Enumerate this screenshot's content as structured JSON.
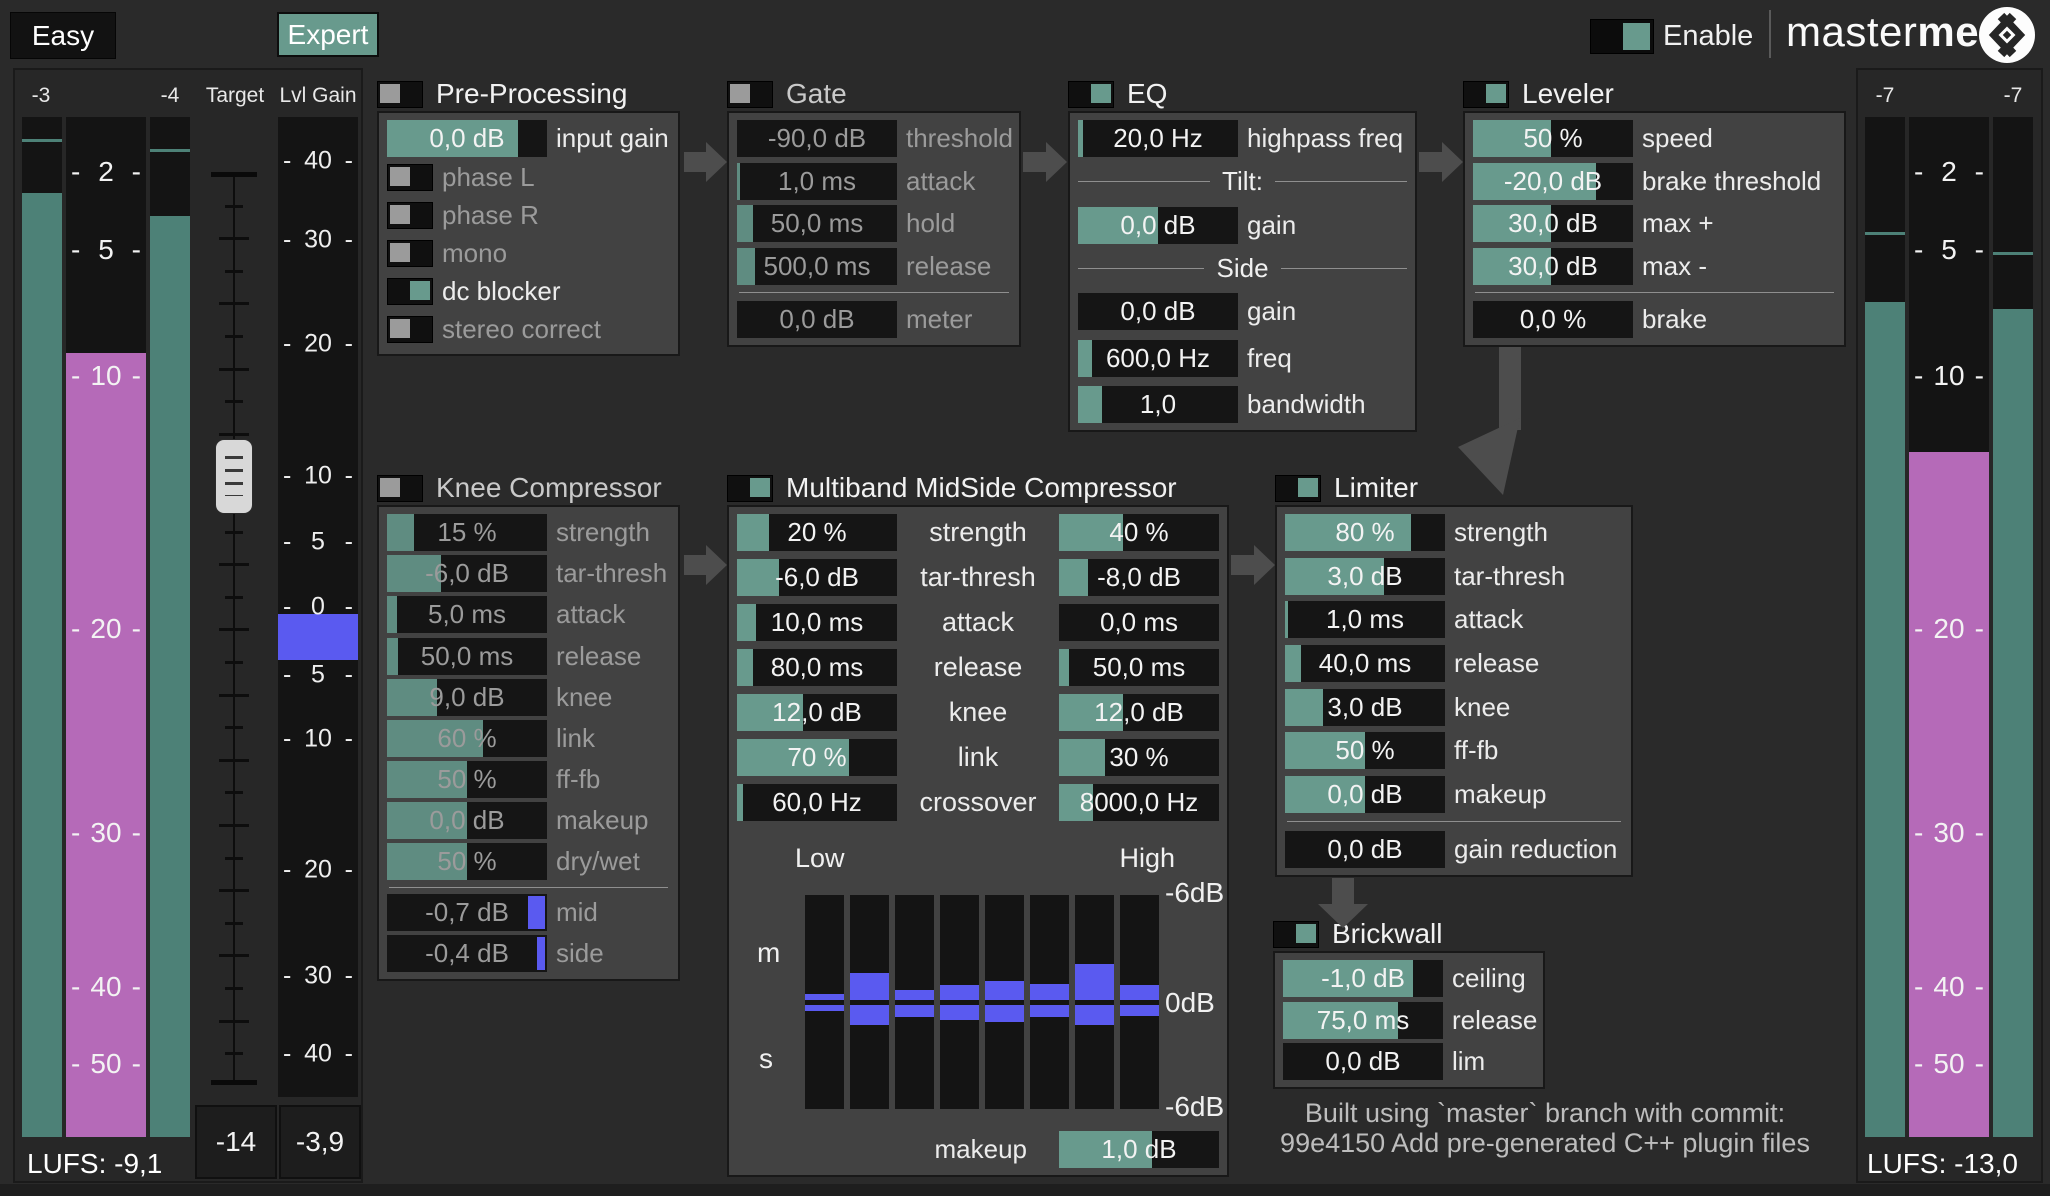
{
  "header": {
    "easy_button": "Easy",
    "expert_button": "Expert",
    "enable_label": "Enable",
    "brand_light": "master",
    "brand_bold": "me"
  },
  "colors": {
    "accent_teal": "#689a8d",
    "meter_teal": "#4d8177",
    "meter_pink": "#b56ab8",
    "meter_blue": "#5a5af0"
  },
  "left_section": {
    "meter_l_label": "-3",
    "meter_r_label": "-4",
    "target_label": "Target",
    "lvl_gain_label": "Lvl Gain",
    "lufs_scale": [
      "2",
      "5",
      "10",
      "20",
      "30",
      "40",
      "50"
    ],
    "gain_scale": [
      "40",
      "30",
      "20",
      "10",
      "5",
      "0",
      "5",
      "10",
      "20",
      "30",
      "40"
    ],
    "lufs_readout": "LUFS: -9,1",
    "target_value": "-14",
    "lvl_gain_value": "-3,9"
  },
  "right_section": {
    "meter_l_label": "-7",
    "meter_r_label": "-7",
    "lufs_scale": [
      "2",
      "5",
      "10",
      "20",
      "30",
      "40",
      "50"
    ],
    "lufs_readout": "LUFS: -13,0"
  },
  "panels": [
    {
      "id": "pre",
      "title": "Pre-Processing",
      "header_toggle": null,
      "disabled": false,
      "rows": [
        {
          "type": "slider",
          "value": "0,0 dB",
          "label": "input gain",
          "fill": 82
        },
        {
          "type": "toggle",
          "label": "phase L",
          "on": false
        },
        {
          "type": "toggle",
          "label": "phase R",
          "on": false
        },
        {
          "type": "toggle",
          "label": "mono",
          "on": false
        },
        {
          "type": "toggle",
          "label": "dc blocker",
          "on": true
        },
        {
          "type": "toggle",
          "label": "stereo correct",
          "on": false
        }
      ]
    },
    {
      "id": "gate",
      "title": "Gate",
      "header_toggle": false,
      "disabled": true,
      "rows": [
        {
          "type": "slider",
          "value": "-90,0 dB",
          "label": "threshold",
          "fill": 0
        },
        {
          "type": "slider",
          "value": "1,0 ms",
          "label": "attack",
          "fill": 2
        },
        {
          "type": "slider",
          "value": "50,0 ms",
          "label": "hold",
          "fill": 10
        },
        {
          "type": "slider",
          "value": "500,0 ms",
          "label": "release",
          "fill": 11
        },
        {
          "type": "separator"
        },
        {
          "type": "display",
          "value": "0,0 dB",
          "label": "meter"
        }
      ]
    },
    {
      "id": "eq",
      "title": "EQ",
      "header_toggle": true,
      "disabled": false,
      "rows": [
        {
          "type": "slider",
          "value": "20,0 Hz",
          "label": "highpass freq",
          "fill": 3
        },
        {
          "type": "heading",
          "label": "Tilt:"
        },
        {
          "type": "slider",
          "value": "0,0 dB",
          "label": "gain",
          "fill": 50
        },
        {
          "type": "heading",
          "label": "Side"
        },
        {
          "type": "slider",
          "value": "0,0 dB",
          "label": "gain",
          "fill": 0
        },
        {
          "type": "slider",
          "value": "600,0 Hz",
          "label": "freq",
          "fill": 9
        },
        {
          "type": "slider",
          "value": "1,0",
          "label": "bandwidth",
          "fill": 15
        }
      ]
    },
    {
      "id": "leveler",
      "title": "Leveler",
      "header_toggle": true,
      "disabled": false,
      "rows": [
        {
          "type": "slider",
          "value": "50 %",
          "label": "speed",
          "fill": 49
        },
        {
          "type": "slider",
          "value": "-20,0 dB",
          "label": "brake threshold",
          "fill": 77
        },
        {
          "type": "slider",
          "value": "30,0 dB",
          "label": "max +",
          "fill": 49
        },
        {
          "type": "slider",
          "value": "30,0 dB",
          "label": "max -",
          "fill": 49
        },
        {
          "type": "separator"
        },
        {
          "type": "display",
          "value": "0,0 %",
          "label": "brake"
        }
      ]
    },
    {
      "id": "knee",
      "title": "Knee Compressor",
      "header_toggle": false,
      "disabled": true,
      "rows": [
        {
          "type": "slider",
          "value": "15 %",
          "label": "strength",
          "fill": 17
        },
        {
          "type": "slider",
          "value": "-6,0 dB",
          "label": "tar-thresh",
          "fill": 34
        },
        {
          "type": "slider",
          "value": "5,0 ms",
          "label": "attack",
          "fill": 6
        },
        {
          "type": "slider",
          "value": "50,0 ms",
          "label": "release",
          "fill": 7
        },
        {
          "type": "slider",
          "value": "9,0 dB",
          "label": "knee",
          "fill": 31
        },
        {
          "type": "slider",
          "value": "60 %",
          "label": "link",
          "fill": 60
        },
        {
          "type": "slider",
          "value": "50 %",
          "label": "ff-fb",
          "fill": 50
        },
        {
          "type": "slider",
          "value": "0,0 dB",
          "label": "makeup",
          "fill": 50
        },
        {
          "type": "slider",
          "value": "50 %",
          "label": "dry/wet",
          "fill": 50
        },
        {
          "type": "separator"
        },
        {
          "type": "meter",
          "value": "-0,7 dB",
          "label": "mid",
          "bar_start": 88,
          "bar_end": 99
        },
        {
          "type": "meter",
          "value": "-0,4 dB",
          "label": "side",
          "bar_start": 94,
          "bar_end": 99
        }
      ]
    },
    {
      "id": "limiter",
      "title": "Limiter",
      "header_toggle": true,
      "disabled": false,
      "rows": [
        {
          "type": "slider",
          "value": "80 %",
          "label": "strength",
          "fill": 79
        },
        {
          "type": "slider",
          "value": "3,0 dB",
          "label": "tar-thresh",
          "fill": 62
        },
        {
          "type": "slider",
          "value": "1,0 ms",
          "label": "attack",
          "fill": 2
        },
        {
          "type": "slider",
          "value": "40,0 ms",
          "label": "release",
          "fill": 10
        },
        {
          "type": "slider",
          "value": "3,0 dB",
          "label": "knee",
          "fill": 24
        },
        {
          "type": "slider",
          "value": "50 %",
          "label": "ff-fb",
          "fill": 50
        },
        {
          "type": "slider",
          "value": "0,0 dB",
          "label": "makeup",
          "fill": 50
        },
        {
          "type": "separator"
        },
        {
          "type": "display",
          "value": "0,0 dB",
          "label": "gain reduction"
        }
      ]
    },
    {
      "id": "brickwall",
      "title": "Brickwall",
      "header_toggle": true,
      "disabled": false,
      "rows": [
        {
          "type": "slider",
          "value": "-1,0 dB",
          "label": "ceiling",
          "fill": 81
        },
        {
          "type": "slider",
          "value": "75,0 ms",
          "label": "release",
          "fill": 72
        },
        {
          "type": "display",
          "value": "0,0 dB",
          "label": "lim"
        }
      ]
    }
  ],
  "multiband": {
    "title": "Multiband MidSide Compressor",
    "header_toggle": true,
    "disabled": false,
    "params": [
      {
        "label": "strength",
        "left_value": "20 %",
        "left_fill": 20,
        "right_value": "40 %",
        "right_fill": 40
      },
      {
        "label": "tar-thresh",
        "left_value": "-6,0 dB",
        "left_fill": 26,
        "right_value": "-8,0 dB",
        "right_fill": 18
      },
      {
        "label": "attack",
        "left_value": "10,0 ms",
        "left_fill": 12,
        "right_value": "0,0 ms",
        "right_fill": 0
      },
      {
        "label": "release",
        "left_value": "80,0 ms",
        "left_fill": 10,
        "right_value": "50,0 ms",
        "right_fill": 6
      },
      {
        "label": "knee",
        "left_value": "12,0 dB",
        "left_fill": 41,
        "right_value": "12,0 dB",
        "right_fill": 40
      },
      {
        "label": "link",
        "left_value": "70 %",
        "left_fill": 70,
        "right_value": "30 %",
        "right_fill": 29
      },
      {
        "label": "crossover",
        "left_value": "60,0 Hz",
        "left_fill": 4,
        "right_value": "8000,0 Hz",
        "right_fill": 21
      }
    ],
    "low_label": "Low",
    "high_label": "High",
    "band_meter": {
      "m_label": "m",
      "s_label": "s",
      "scale_top_label": "-6dB",
      "scale_mid_label": "0dB",
      "scale_bottom_label": "-6dB",
      "db_range": 6,
      "m_reduction_db": [
        0.35,
        1.5,
        0.55,
        0.85,
        1.05,
        0.9,
        2.0,
        0.85
      ],
      "s_reduction_db": [
        0.35,
        1.1,
        0.65,
        0.85,
        0.95,
        0.7,
        1.1,
        0.6
      ]
    },
    "makeup": {
      "label": "makeup",
      "value": "1,0 dB",
      "fill": 58
    }
  },
  "footer": {
    "build_line1": "Built using `master` branch with commit:",
    "build_line2": "99e4150 Add pre-generated C++ plugin files"
  }
}
